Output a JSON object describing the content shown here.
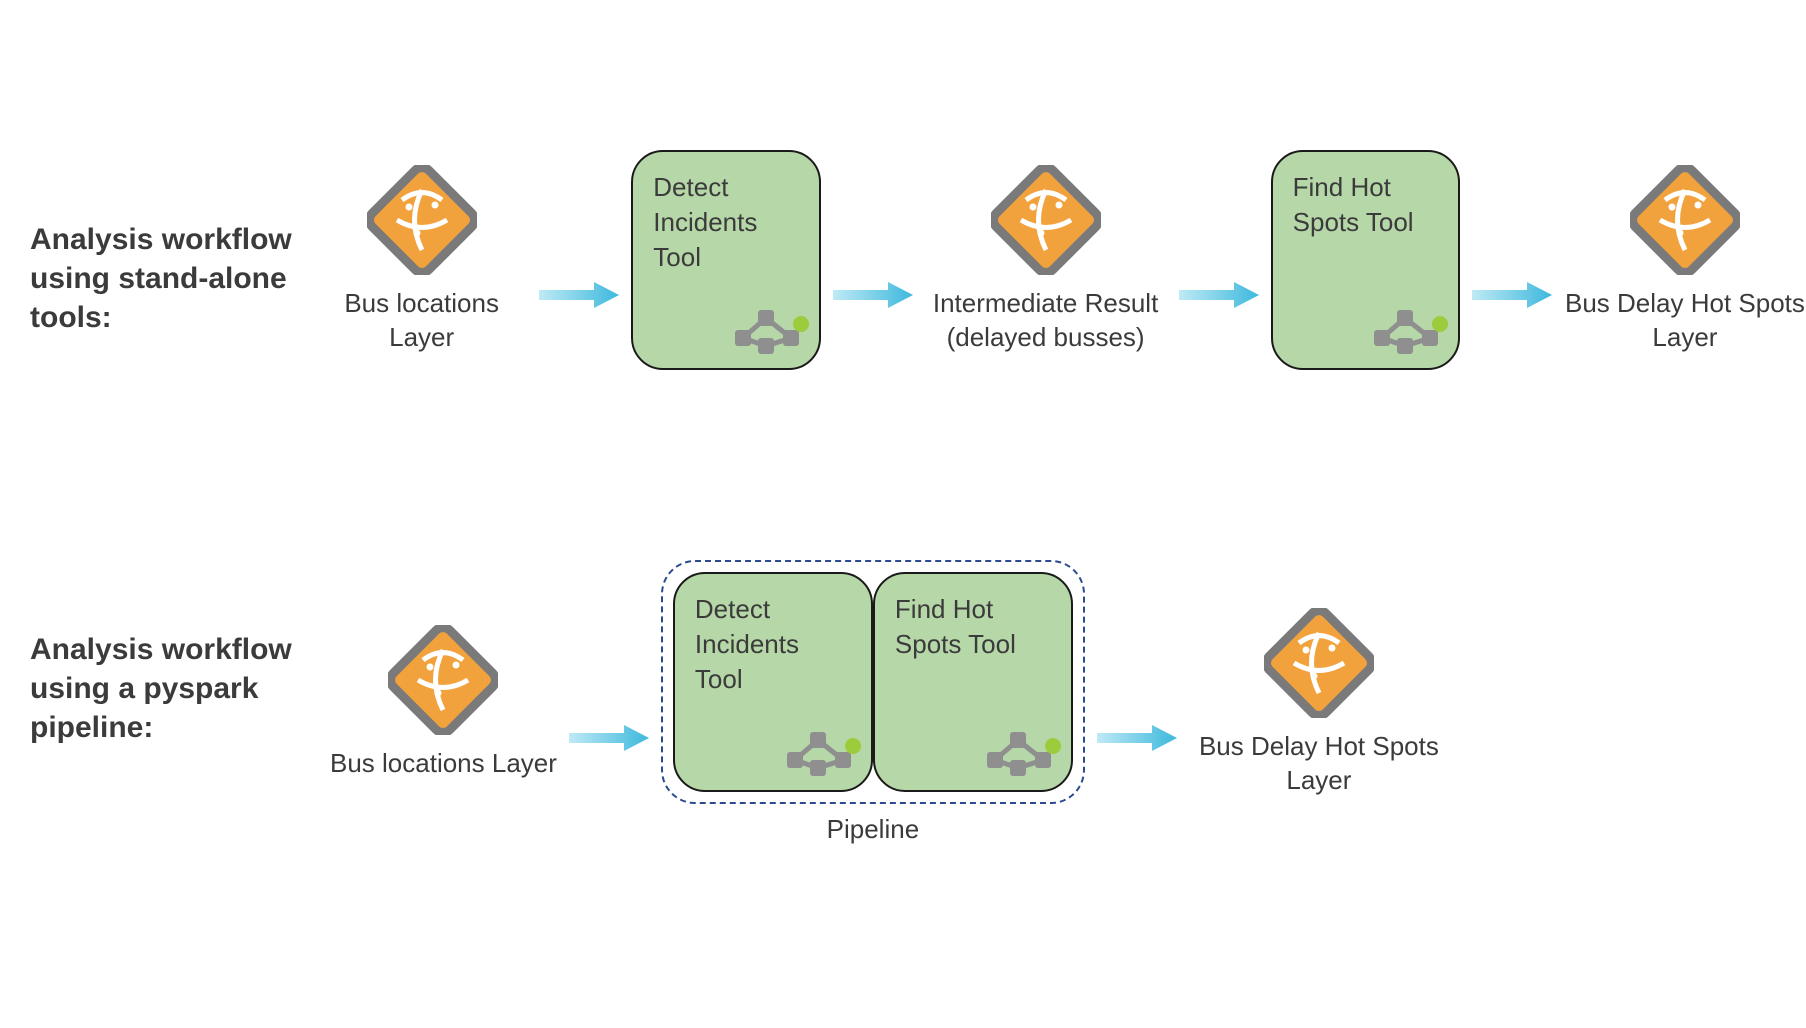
{
  "row1": {
    "label": "Analysis workflow using stand-alone tools:",
    "n1": "Bus locations Layer",
    "t1": "Detect Incidents Tool",
    "n2": "Intermediate Result (delayed busses)",
    "t2": "Find Hot Spots Tool",
    "n3": "Bus Delay Hot Spots Layer"
  },
  "row2": {
    "label": "Analysis workflow using a pyspark pipeline:",
    "n1": "Bus locations Layer",
    "t1": "Detect Incidents Tool",
    "t2": "Find Hot Spots Tool",
    "pipeline_label": "Pipeline",
    "n2": "Bus Delay Hot Spots Layer"
  },
  "colors": {
    "tool_fill": "#b6d7a8",
    "arrow": "#5dc6e8",
    "diamond_border": "#7a7a7a",
    "diamond_fill": "#f2a23c",
    "pipeline_border": "#2b4a8f"
  }
}
